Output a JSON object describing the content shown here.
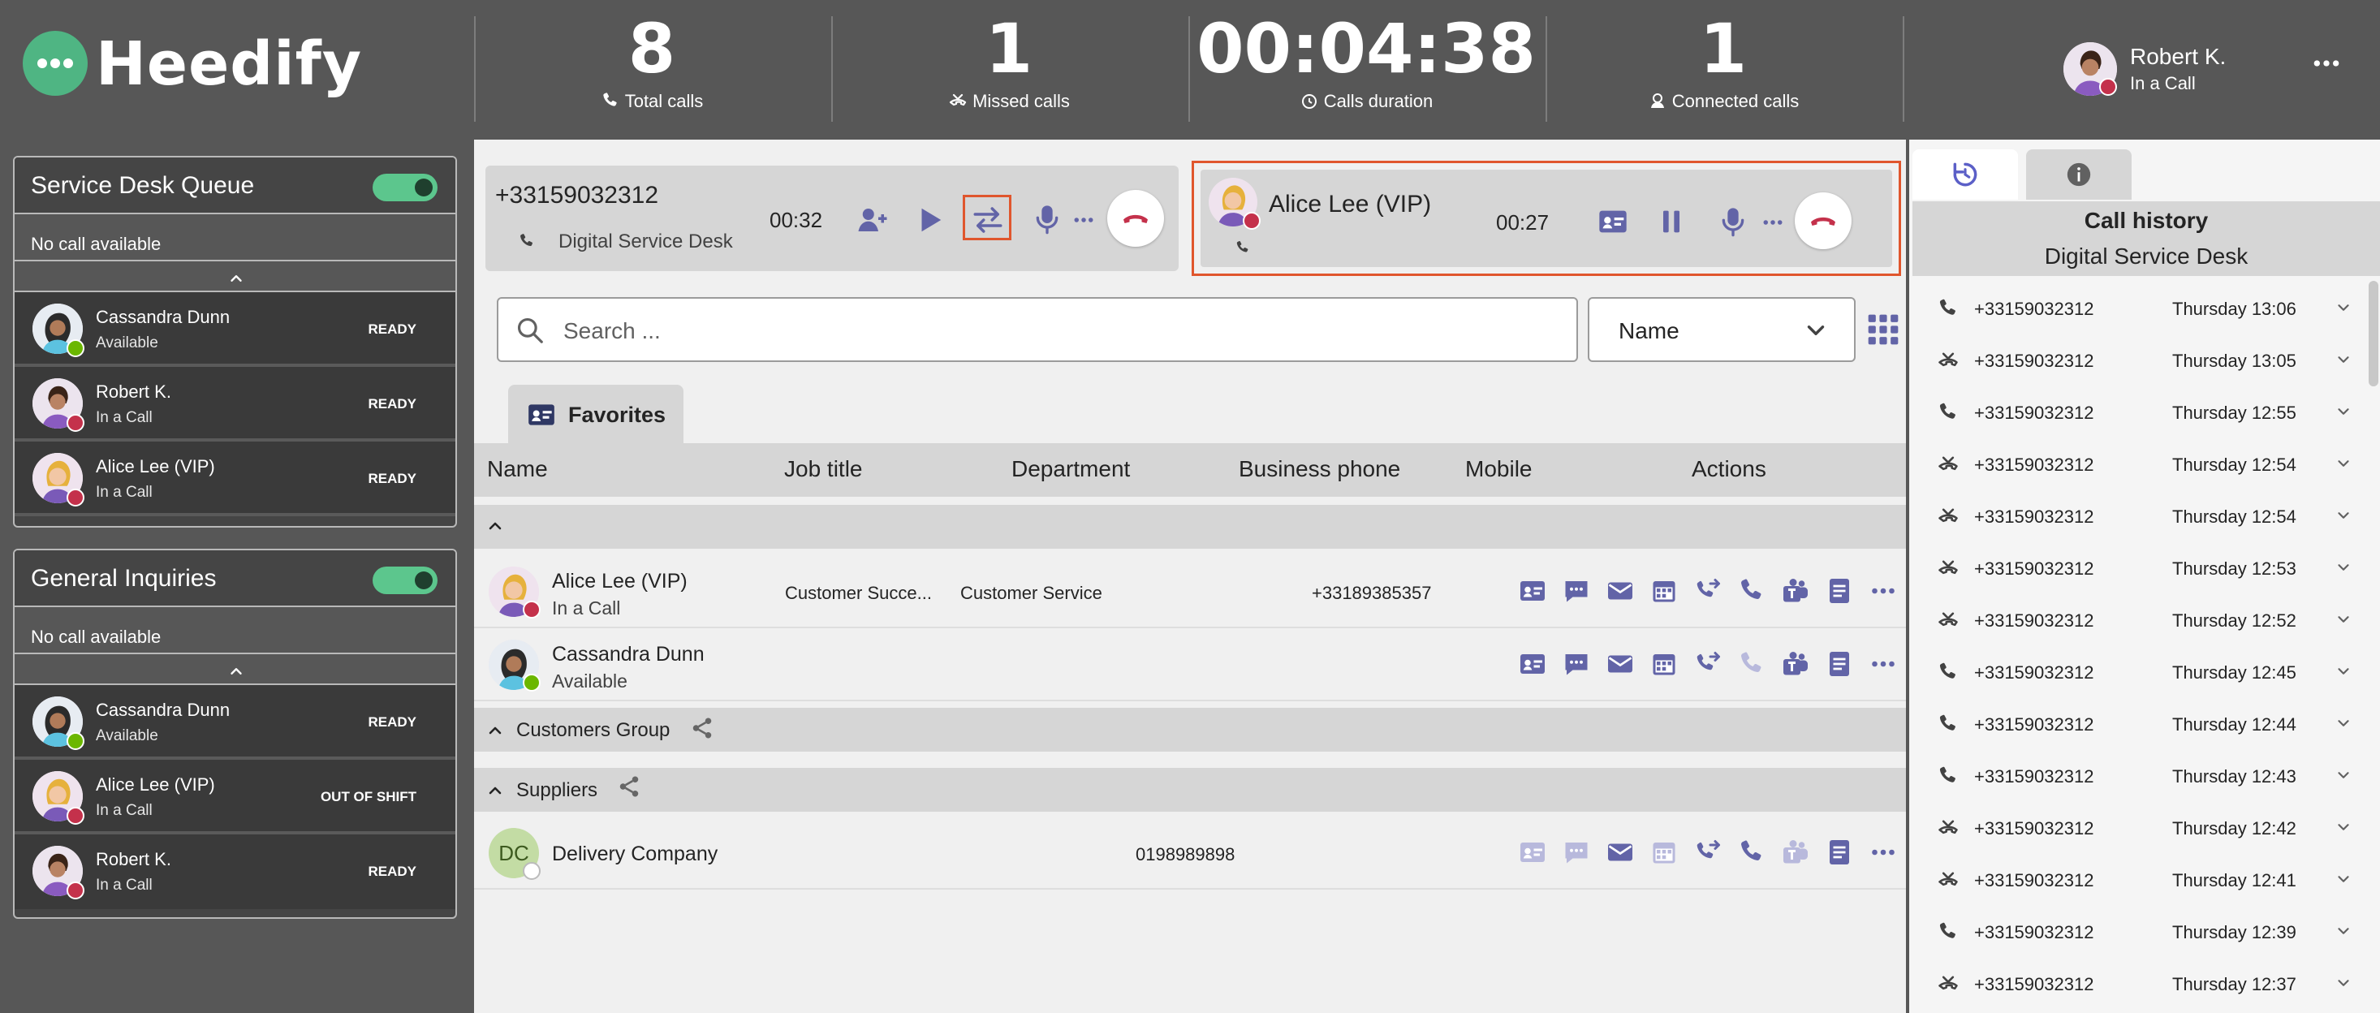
{
  "brand": {
    "name": "Heedify",
    "accent": "#4fb583"
  },
  "stats": [
    {
      "value": "8",
      "label": "Total calls",
      "icon": "phone-icon"
    },
    {
      "value": "1",
      "label": "Missed calls",
      "icon": "missed-call-icon"
    },
    {
      "value": "00:04:38",
      "label": "Calls duration",
      "icon": "timer-icon"
    },
    {
      "value": "1",
      "label": "Connected calls",
      "icon": "agent-icon"
    }
  ],
  "user": {
    "name": "Robert K.",
    "status": "In a Call"
  },
  "queues": [
    {
      "title": "Service Desk Queue",
      "no_call": "No call available",
      "agents": [
        {
          "name": "Cassandra Dunn",
          "status": "Available",
          "state": "READY"
        },
        {
          "name": "Robert K.",
          "status": "In a Call",
          "state": "READY"
        },
        {
          "name": "Alice Lee (VIP)",
          "status": "In a Call",
          "state": "READY"
        }
      ]
    },
    {
      "title": "General Inquiries",
      "no_call": "No call available",
      "agents": [
        {
          "name": "Cassandra Dunn",
          "status": "Available",
          "state": "READY"
        },
        {
          "name": "Alice Lee (VIP)",
          "status": "In a Call",
          "state": "OUT OF SHIFT"
        },
        {
          "name": "Robert K.",
          "status": "In a Call",
          "state": "READY"
        }
      ]
    }
  ],
  "calls": [
    {
      "number": "+33159032312",
      "source": "Digital Service Desk",
      "timer": "00:32"
    },
    {
      "name": "Alice Lee (VIP)",
      "timer": "00:27"
    }
  ],
  "search": {
    "placeholder": "Search ..."
  },
  "sort": {
    "selected": "Name"
  },
  "tabs": {
    "favorites": "Favorites"
  },
  "columns": [
    "Name",
    "Job title",
    "Department",
    "Business phone",
    "Mobile",
    "Actions"
  ],
  "contacts": [
    {
      "name": "Alice Lee (VIP)",
      "status": "In a Call",
      "job": "Customer Succe...",
      "dept": "Customer Service",
      "business": "+33189385357",
      "mobile": ""
    },
    {
      "name": "Cassandra Dunn",
      "status": "Available",
      "job": "",
      "dept": "",
      "business": "",
      "mobile": ""
    }
  ],
  "groups": {
    "customers": "Customers Group",
    "suppliers": "Suppliers"
  },
  "supplier": {
    "initials": "DC",
    "name": "Delivery Company",
    "business": "0198989898"
  },
  "history": {
    "title": "Call history",
    "subtitle": "Digital Service Desk",
    "items": [
      {
        "number": "+33159032312",
        "time": "Thursday 13:06",
        "type": "incoming"
      },
      {
        "number": "+33159032312",
        "time": "Thursday 13:05",
        "type": "missed"
      },
      {
        "number": "+33159032312",
        "time": "Thursday 12:55",
        "type": "incoming"
      },
      {
        "number": "+33159032312",
        "time": "Thursday 12:54",
        "type": "missed"
      },
      {
        "number": "+33159032312",
        "time": "Thursday 12:54",
        "type": "missed"
      },
      {
        "number": "+33159032312",
        "time": "Thursday 12:53",
        "type": "missed"
      },
      {
        "number": "+33159032312",
        "time": "Thursday 12:52",
        "type": "missed"
      },
      {
        "number": "+33159032312",
        "time": "Thursday 12:45",
        "type": "incoming"
      },
      {
        "number": "+33159032312",
        "time": "Thursday 12:44",
        "type": "incoming"
      },
      {
        "number": "+33159032312",
        "time": "Thursday 12:43",
        "type": "incoming"
      },
      {
        "number": "+33159032312",
        "time": "Thursday 12:42",
        "type": "missed"
      },
      {
        "number": "+33159032312",
        "time": "Thursday 12:41",
        "type": "missed"
      },
      {
        "number": "+33159032312",
        "time": "Thursday 12:39",
        "type": "incoming"
      },
      {
        "number": "+33159032312",
        "time": "Thursday 12:37",
        "type": "missed"
      }
    ]
  }
}
